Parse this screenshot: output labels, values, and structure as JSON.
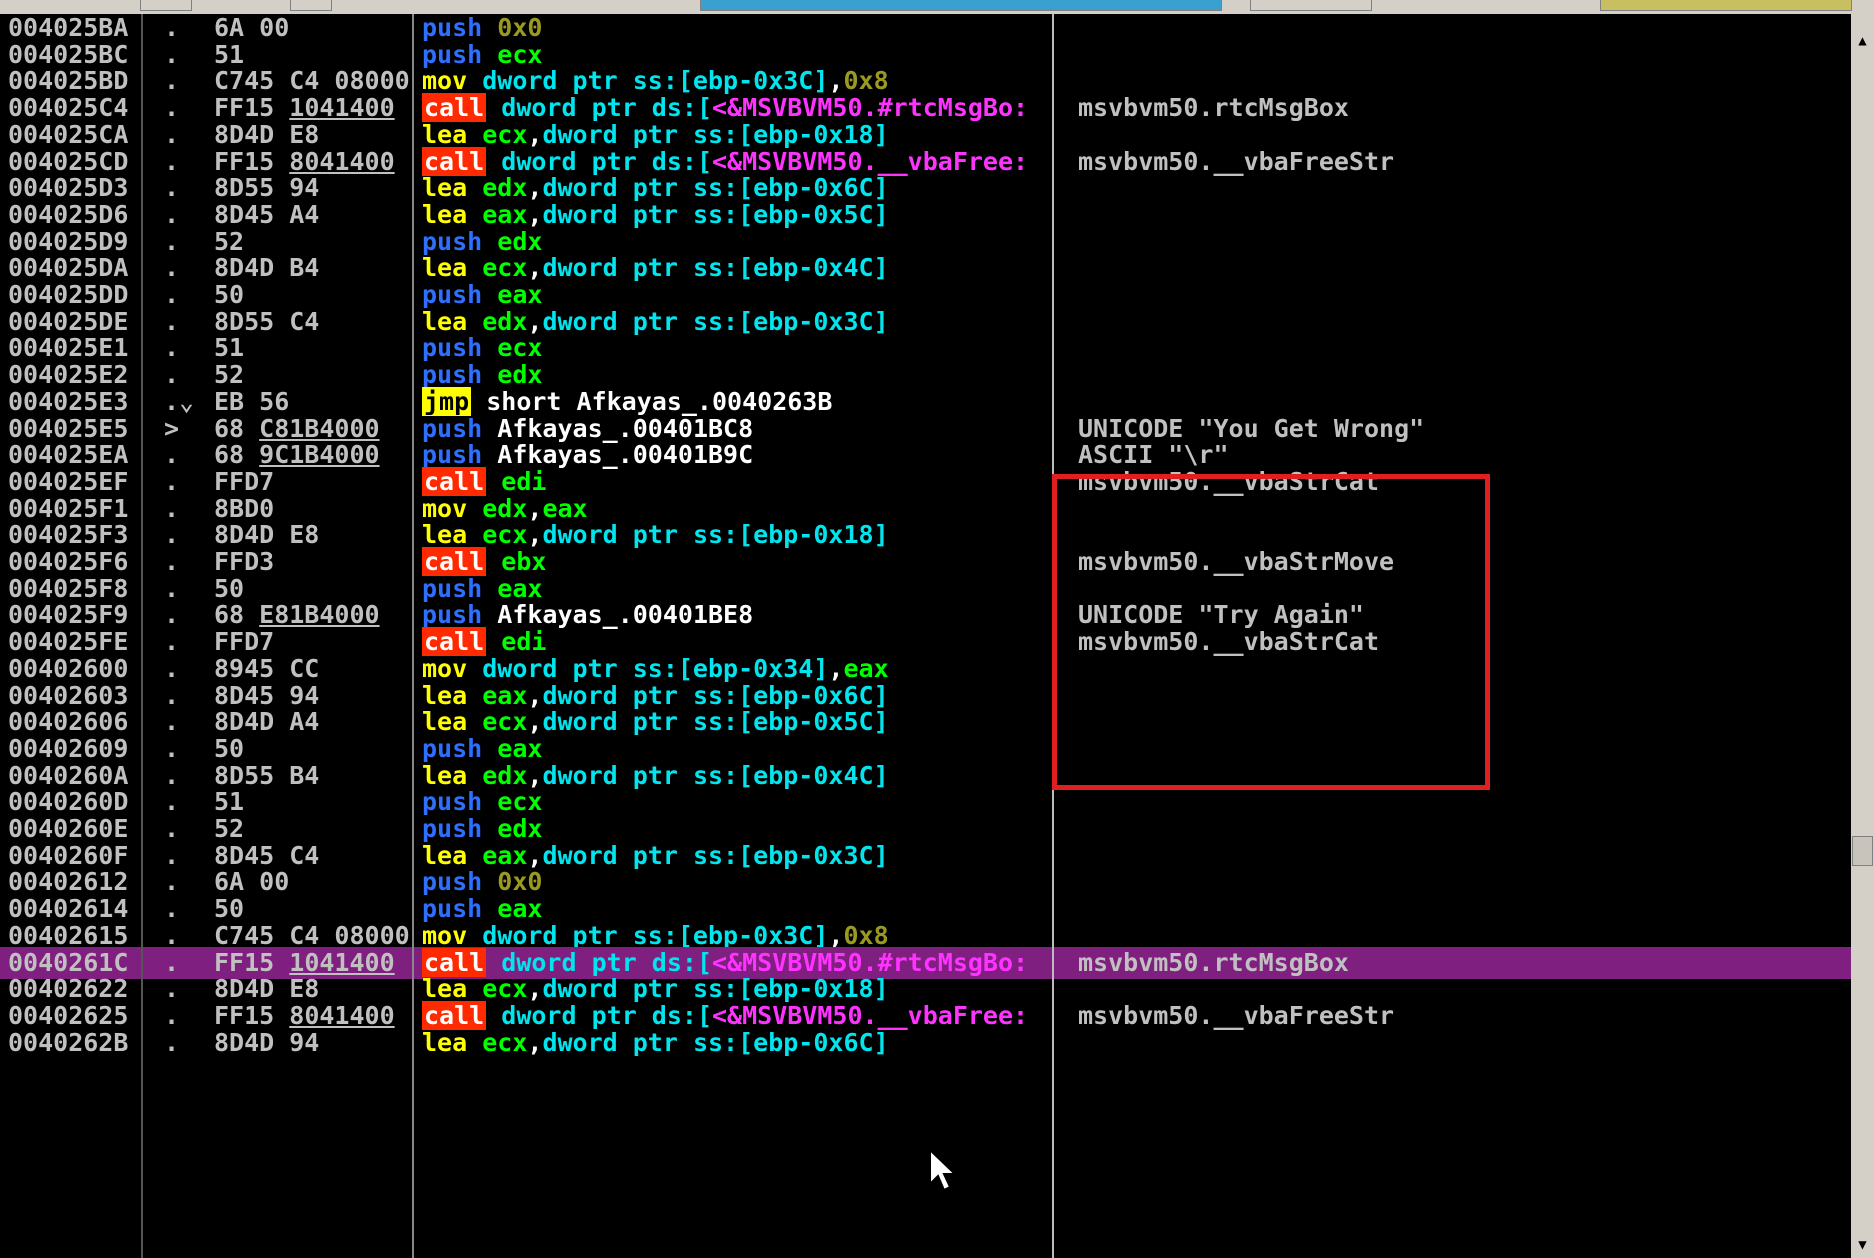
{
  "colors": {
    "background": "#000000",
    "selected_row": "#7f1f7f",
    "highlight_box": "#e02020",
    "call_bg": "#ff2a00",
    "jmp_bg": "#ffff00"
  },
  "rows": [
    {
      "addr": "004025BA",
      "mark": ".",
      "hex": [
        {
          "t": "6A 00"
        }
      ],
      "dis": [
        {
          "k": "push",
          "c": "kw-push"
        },
        {
          "t": " "
        },
        {
          "t": "0x0",
          "c": "t-imm"
        }
      ],
      "comment": ""
    },
    {
      "addr": "004025BC",
      "mark": ".",
      "hex": [
        {
          "t": "51"
        }
      ],
      "dis": [
        {
          "k": "push",
          "c": "kw-push"
        },
        {
          "t": " "
        },
        {
          "t": "ecx",
          "c": "t-reg"
        }
      ],
      "comment": ""
    },
    {
      "addr": "004025BD",
      "mark": ".",
      "hex": [
        {
          "t": "C745 C4 08000"
        }
      ],
      "dis": [
        {
          "k": "mov",
          "c": "kw-mov"
        },
        {
          "t": " "
        },
        {
          "t": "dword ptr ss:[ebp-0x3C]",
          "c": "t-mem"
        },
        {
          "t": ",",
          "c": "t-punc"
        },
        {
          "t": "0x8",
          "c": "t-imm"
        }
      ],
      "comment": ""
    },
    {
      "addr": "004025C4",
      "mark": ".",
      "hex": [
        {
          "t": "FF15 "
        },
        {
          "t": "1041400",
          "u": true
        }
      ],
      "dis": [
        {
          "k": "call",
          "c": "kw-call"
        },
        {
          "t": " "
        },
        {
          "t": "dword ptr ds:[",
          "c": "t-mem"
        },
        {
          "t": "<&MSVBVM50.#rtcMsgBo:",
          "c": "t-api"
        }
      ],
      "comment": "msvbvm50.rtcMsgBox"
    },
    {
      "addr": "004025CA",
      "mark": ".",
      "hex": [
        {
          "t": "8D4D E8"
        }
      ],
      "dis": [
        {
          "k": "lea",
          "c": "kw-lea"
        },
        {
          "t": " "
        },
        {
          "t": "ecx",
          "c": "t-reg"
        },
        {
          "t": ",",
          "c": "t-punc"
        },
        {
          "t": "dword ptr ss:[ebp-0x18]",
          "c": "t-mem"
        }
      ],
      "comment": ""
    },
    {
      "addr": "004025CD",
      "mark": ".",
      "hex": [
        {
          "t": "FF15 "
        },
        {
          "t": "8041400",
          "u": true
        }
      ],
      "dis": [
        {
          "k": "call",
          "c": "kw-call"
        },
        {
          "t": " "
        },
        {
          "t": "dword ptr ds:[",
          "c": "t-mem"
        },
        {
          "t": "<&MSVBVM50.__vbaFree:",
          "c": "t-api"
        }
      ],
      "comment": "msvbvm50.__vbaFreeStr"
    },
    {
      "addr": "004025D3",
      "mark": ".",
      "hex": [
        {
          "t": "8D55 94"
        }
      ],
      "dis": [
        {
          "k": "lea",
          "c": "kw-lea"
        },
        {
          "t": " "
        },
        {
          "t": "edx",
          "c": "t-reg"
        },
        {
          "t": ",",
          "c": "t-punc"
        },
        {
          "t": "dword ptr ss:[ebp-0x6C]",
          "c": "t-mem"
        }
      ],
      "comment": ""
    },
    {
      "addr": "004025D6",
      "mark": ".",
      "hex": [
        {
          "t": "8D45 A4"
        }
      ],
      "dis": [
        {
          "k": "lea",
          "c": "kw-lea"
        },
        {
          "t": " "
        },
        {
          "t": "eax",
          "c": "t-reg"
        },
        {
          "t": ",",
          "c": "t-punc"
        },
        {
          "t": "dword ptr ss:[ebp-0x5C]",
          "c": "t-mem"
        }
      ],
      "comment": ""
    },
    {
      "addr": "004025D9",
      "mark": ".",
      "hex": [
        {
          "t": "52"
        }
      ],
      "dis": [
        {
          "k": "push",
          "c": "kw-push"
        },
        {
          "t": " "
        },
        {
          "t": "edx",
          "c": "t-reg"
        }
      ],
      "comment": ""
    },
    {
      "addr": "004025DA",
      "mark": ".",
      "hex": [
        {
          "t": "8D4D B4"
        }
      ],
      "dis": [
        {
          "k": "lea",
          "c": "kw-lea"
        },
        {
          "t": " "
        },
        {
          "t": "ecx",
          "c": "t-reg"
        },
        {
          "t": ",",
          "c": "t-punc"
        },
        {
          "t": "dword ptr ss:[ebp-0x4C]",
          "c": "t-mem"
        }
      ],
      "comment": ""
    },
    {
      "addr": "004025DD",
      "mark": ".",
      "hex": [
        {
          "t": "50"
        }
      ],
      "dis": [
        {
          "k": "push",
          "c": "kw-push"
        },
        {
          "t": " "
        },
        {
          "t": "eax",
          "c": "t-reg"
        }
      ],
      "comment": ""
    },
    {
      "addr": "004025DE",
      "mark": ".",
      "hex": [
        {
          "t": "8D55 C4"
        }
      ],
      "dis": [
        {
          "k": "lea",
          "c": "kw-lea"
        },
        {
          "t": " "
        },
        {
          "t": "edx",
          "c": "t-reg"
        },
        {
          "t": ",",
          "c": "t-punc"
        },
        {
          "t": "dword ptr ss:[ebp-0x3C]",
          "c": "t-mem"
        }
      ],
      "comment": ""
    },
    {
      "addr": "004025E1",
      "mark": ".",
      "hex": [
        {
          "t": "51"
        }
      ],
      "dis": [
        {
          "k": "push",
          "c": "kw-push"
        },
        {
          "t": " "
        },
        {
          "t": "ecx",
          "c": "t-reg"
        }
      ],
      "comment": ""
    },
    {
      "addr": "004025E2",
      "mark": ".",
      "hex": [
        {
          "t": "52"
        }
      ],
      "dis": [
        {
          "k": "push",
          "c": "kw-push"
        },
        {
          "t": " "
        },
        {
          "t": "edx",
          "c": "t-reg"
        }
      ],
      "comment": ""
    },
    {
      "addr": "004025E3",
      "mark": ".⌄",
      "hex": [
        {
          "t": "EB 56"
        }
      ],
      "dis": [
        {
          "k": "jmp",
          "c": "kw-jmp"
        },
        {
          "t": " "
        },
        {
          "t": "short Afkayas_.0040263B",
          "c": "t-plain"
        }
      ],
      "comment": ""
    },
    {
      "addr": "004025E5",
      "mark": ">",
      "hex": [
        {
          "t": "68 "
        },
        {
          "t": "C81B4000",
          "u": true
        }
      ],
      "dis": [
        {
          "k": "push",
          "c": "kw-push"
        },
        {
          "t": " "
        },
        {
          "t": "Afkayas_.00401BC8",
          "c": "t-plain"
        }
      ],
      "comment": "UNICODE \"You Get Wrong\""
    },
    {
      "addr": "004025EA",
      "mark": ".",
      "hex": [
        {
          "t": "68 "
        },
        {
          "t": "9C1B4000",
          "u": true
        }
      ],
      "dis": [
        {
          "k": "push",
          "c": "kw-push"
        },
        {
          "t": " "
        },
        {
          "t": "Afkayas_.00401B9C",
          "c": "t-plain"
        }
      ],
      "comment": "ASCII \"\\r\""
    },
    {
      "addr": "004025EF",
      "mark": ".",
      "hex": [
        {
          "t": "FFD7"
        }
      ],
      "dis": [
        {
          "k": "call",
          "c": "kw-call"
        },
        {
          "t": " "
        },
        {
          "t": "edi",
          "c": "t-reg"
        }
      ],
      "comment": "msvbvm50.__vbaStrCat"
    },
    {
      "addr": "004025F1",
      "mark": ".",
      "hex": [
        {
          "t": "8BD0"
        }
      ],
      "dis": [
        {
          "k": "mov",
          "c": "kw-mov"
        },
        {
          "t": " "
        },
        {
          "t": "edx",
          "c": "t-reg"
        },
        {
          "t": ",",
          "c": "t-punc"
        },
        {
          "t": "eax",
          "c": "t-reg"
        }
      ],
      "comment": ""
    },
    {
      "addr": "004025F3",
      "mark": ".",
      "hex": [
        {
          "t": "8D4D E8"
        }
      ],
      "dis": [
        {
          "k": "lea",
          "c": "kw-lea"
        },
        {
          "t": " "
        },
        {
          "t": "ecx",
          "c": "t-reg"
        },
        {
          "t": ",",
          "c": "t-punc"
        },
        {
          "t": "dword ptr ss:[ebp-0x18]",
          "c": "t-mem"
        }
      ],
      "comment": ""
    },
    {
      "addr": "004025F6",
      "mark": ".",
      "hex": [
        {
          "t": "FFD3"
        }
      ],
      "dis": [
        {
          "k": "call",
          "c": "kw-call"
        },
        {
          "t": " "
        },
        {
          "t": "ebx",
          "c": "t-reg"
        }
      ],
      "comment": "msvbvm50.__vbaStrMove"
    },
    {
      "addr": "004025F8",
      "mark": ".",
      "hex": [
        {
          "t": "50"
        }
      ],
      "dis": [
        {
          "k": "push",
          "c": "kw-push"
        },
        {
          "t": " "
        },
        {
          "t": "eax",
          "c": "t-reg"
        }
      ],
      "comment": ""
    },
    {
      "addr": "004025F9",
      "mark": ".",
      "hex": [
        {
          "t": "68 "
        },
        {
          "t": "E81B4000",
          "u": true
        }
      ],
      "dis": [
        {
          "k": "push",
          "c": "kw-push"
        },
        {
          "t": " "
        },
        {
          "t": "Afkayas_.00401BE8",
          "c": "t-plain"
        }
      ],
      "comment": "UNICODE \"Try Again\""
    },
    {
      "addr": "004025FE",
      "mark": ".",
      "hex": [
        {
          "t": "FFD7"
        }
      ],
      "dis": [
        {
          "k": "call",
          "c": "kw-call"
        },
        {
          "t": " "
        },
        {
          "t": "edi",
          "c": "t-reg"
        }
      ],
      "comment": "msvbvm50.__vbaStrCat"
    },
    {
      "addr": "00402600",
      "mark": ".",
      "hex": [
        {
          "t": "8945 CC"
        }
      ],
      "dis": [
        {
          "k": "mov",
          "c": "kw-mov"
        },
        {
          "t": " "
        },
        {
          "t": "dword ptr ss:[ebp-0x34]",
          "c": "t-mem"
        },
        {
          "t": ",",
          "c": "t-punc"
        },
        {
          "t": "eax",
          "c": "t-reg"
        }
      ],
      "comment": ""
    },
    {
      "addr": "00402603",
      "mark": ".",
      "hex": [
        {
          "t": "8D45 94"
        }
      ],
      "dis": [
        {
          "k": "lea",
          "c": "kw-lea"
        },
        {
          "t": " "
        },
        {
          "t": "eax",
          "c": "t-reg"
        },
        {
          "t": ",",
          "c": "t-punc"
        },
        {
          "t": "dword ptr ss:[ebp-0x6C]",
          "c": "t-mem"
        }
      ],
      "comment": ""
    },
    {
      "addr": "00402606",
      "mark": ".",
      "hex": [
        {
          "t": "8D4D A4"
        }
      ],
      "dis": [
        {
          "k": "lea",
          "c": "kw-lea"
        },
        {
          "t": " "
        },
        {
          "t": "ecx",
          "c": "t-reg"
        },
        {
          "t": ",",
          "c": "t-punc"
        },
        {
          "t": "dword ptr ss:[ebp-0x5C]",
          "c": "t-mem"
        }
      ],
      "comment": ""
    },
    {
      "addr": "00402609",
      "mark": ".",
      "hex": [
        {
          "t": "50"
        }
      ],
      "dis": [
        {
          "k": "push",
          "c": "kw-push"
        },
        {
          "t": " "
        },
        {
          "t": "eax",
          "c": "t-reg"
        }
      ],
      "comment": ""
    },
    {
      "addr": "0040260A",
      "mark": ".",
      "hex": [
        {
          "t": "8D55 B4"
        }
      ],
      "dis": [
        {
          "k": "lea",
          "c": "kw-lea"
        },
        {
          "t": " "
        },
        {
          "t": "edx",
          "c": "t-reg"
        },
        {
          "t": ",",
          "c": "t-punc"
        },
        {
          "t": "dword ptr ss:[ebp-0x4C]",
          "c": "t-mem"
        }
      ],
      "comment": ""
    },
    {
      "addr": "0040260D",
      "mark": ".",
      "hex": [
        {
          "t": "51"
        }
      ],
      "dis": [
        {
          "k": "push",
          "c": "kw-push"
        },
        {
          "t": " "
        },
        {
          "t": "ecx",
          "c": "t-reg"
        }
      ],
      "comment": ""
    },
    {
      "addr": "0040260E",
      "mark": ".",
      "hex": [
        {
          "t": "52"
        }
      ],
      "dis": [
        {
          "k": "push",
          "c": "kw-push"
        },
        {
          "t": " "
        },
        {
          "t": "edx",
          "c": "t-reg"
        }
      ],
      "comment": ""
    },
    {
      "addr": "0040260F",
      "mark": ".",
      "hex": [
        {
          "t": "8D45 C4"
        }
      ],
      "dis": [
        {
          "k": "lea",
          "c": "kw-lea"
        },
        {
          "t": " "
        },
        {
          "t": "eax",
          "c": "t-reg"
        },
        {
          "t": ",",
          "c": "t-punc"
        },
        {
          "t": "dword ptr ss:[ebp-0x3C]",
          "c": "t-mem"
        }
      ],
      "comment": ""
    },
    {
      "addr": "00402612",
      "mark": ".",
      "hex": [
        {
          "t": "6A 00"
        }
      ],
      "dis": [
        {
          "k": "push",
          "c": "kw-push"
        },
        {
          "t": " "
        },
        {
          "t": "0x0",
          "c": "t-imm"
        }
      ],
      "comment": ""
    },
    {
      "addr": "00402614",
      "mark": ".",
      "hex": [
        {
          "t": "50"
        }
      ],
      "dis": [
        {
          "k": "push",
          "c": "kw-push"
        },
        {
          "t": " "
        },
        {
          "t": "eax",
          "c": "t-reg"
        }
      ],
      "comment": ""
    },
    {
      "addr": "00402615",
      "mark": ".",
      "hex": [
        {
          "t": "C745 C4 08000"
        }
      ],
      "dis": [
        {
          "k": "mov",
          "c": "kw-mov"
        },
        {
          "t": " "
        },
        {
          "t": "dword ptr ss:[ebp-0x3C]",
          "c": "t-mem"
        },
        {
          "t": ",",
          "c": "t-punc"
        },
        {
          "t": "0x8",
          "c": "t-imm"
        }
      ],
      "comment": ""
    },
    {
      "addr": "0040261C",
      "mark": ".",
      "selected": true,
      "hex": [
        {
          "t": "FF15 "
        },
        {
          "t": "1041400",
          "u": true
        }
      ],
      "dis": [
        {
          "k": "call",
          "c": "kw-call"
        },
        {
          "t": " "
        },
        {
          "t": "dword ptr ds:[",
          "c": "t-mem"
        },
        {
          "t": "<&MSVBVM50.#rtcMsgBo:",
          "c": "t-api"
        }
      ],
      "comment": "msvbvm50.rtcMsgBox"
    },
    {
      "addr": "00402622",
      "mark": ".",
      "hex": [
        {
          "t": "8D4D E8"
        }
      ],
      "dis": [
        {
          "k": "lea",
          "c": "kw-lea"
        },
        {
          "t": " "
        },
        {
          "t": "ecx",
          "c": "t-reg"
        },
        {
          "t": ",",
          "c": "t-punc"
        },
        {
          "t": "dword ptr ss:[ebp-0x18]",
          "c": "t-mem"
        }
      ],
      "comment": ""
    },
    {
      "addr": "00402625",
      "mark": ".",
      "hex": [
        {
          "t": "FF15 "
        },
        {
          "t": "8041400",
          "u": true
        }
      ],
      "dis": [
        {
          "k": "call",
          "c": "kw-call"
        },
        {
          "t": " "
        },
        {
          "t": "dword ptr ds:[",
          "c": "t-mem"
        },
        {
          "t": "<&MSVBVM50.__vbaFree:",
          "c": "t-api"
        }
      ],
      "comment": "msvbvm50.__vbaFreeStr"
    },
    {
      "addr": "0040262B",
      "mark": ".",
      "hex": [
        {
          "t": "8D4D 94"
        }
      ],
      "dis": [
        {
          "k": "lea",
          "c": "kw-lea"
        },
        {
          "t": " "
        },
        {
          "t": "ecx",
          "c": "t-reg"
        },
        {
          "t": ",",
          "c": "t-punc"
        },
        {
          "t": "dword ptr ss:[ebp-0x6C]",
          "c": "t-mem"
        }
      ],
      "comment": ""
    }
  ],
  "scrollbar": {
    "up_icon": "arrow-up-icon",
    "down_icon": "arrow-down-icon"
  }
}
